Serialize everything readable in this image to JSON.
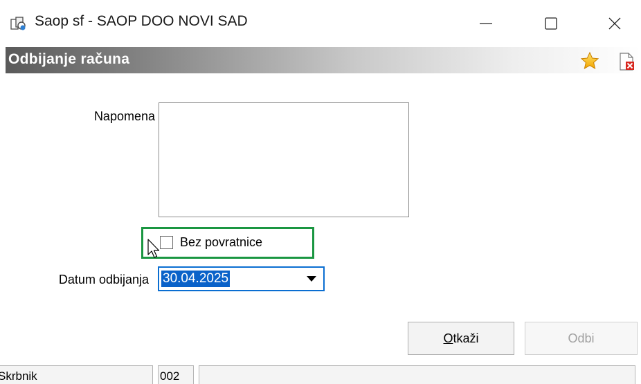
{
  "window": {
    "title": "Saop sf - SAOP DOO NOVI SAD"
  },
  "header": {
    "title": "Odbijanje računa"
  },
  "form": {
    "napomena_label": "Napomena",
    "napomena_value": "",
    "bez_povratnice_label": "Bez povratnice",
    "bez_povratnice_checked": false,
    "datum_label": "Datum odbijanja",
    "datum_value": "30.04.2025"
  },
  "buttons": {
    "cancel_first": "O",
    "cancel_rest": "tkaži",
    "reject": "Odbi"
  },
  "statusbar": {
    "cell1": "Skrbnik",
    "cell2": "002",
    "cell3": ""
  },
  "colors": {
    "highlight": "#1a9641",
    "focus": "#0a6ed1",
    "selection": "#0a62c9"
  },
  "icons": [
    "app-icon",
    "minimize-icon",
    "maximize-icon",
    "close-icon",
    "star-icon",
    "document-close-icon",
    "dropdown-arrow-icon",
    "mouse-cursor-icon"
  ]
}
